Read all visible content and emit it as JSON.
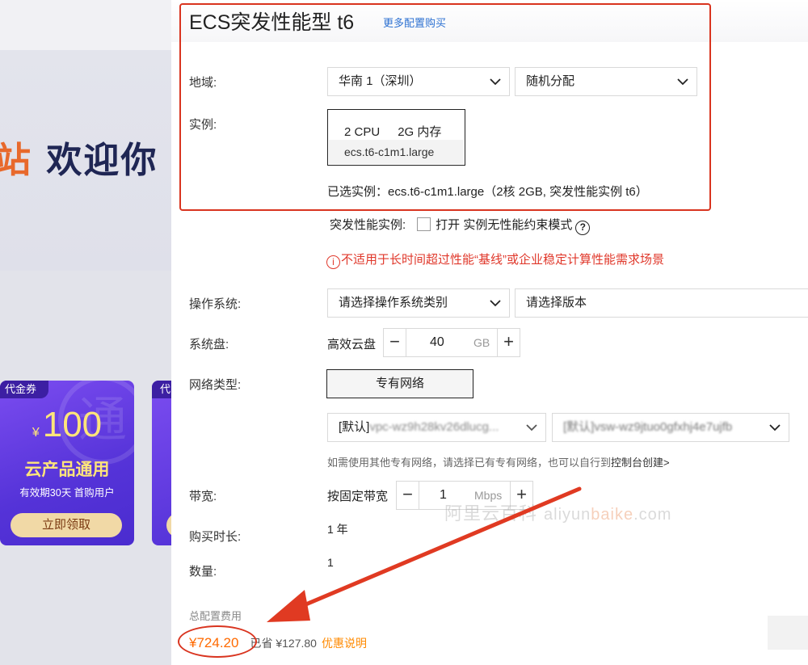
{
  "background": {
    "welcome_orange": "站",
    "welcome_navy": " 欢迎你",
    "coupon": {
      "tag": "代金券",
      "currency": "¥",
      "amount": "100",
      "title": "云产品通用",
      "subtitle": "有效期30天 首购用户",
      "claim_label": "立即领取",
      "deco": "通"
    },
    "coupon2": {
      "tag": "代"
    }
  },
  "config": {
    "product_title": "ECS突发性能型 t6",
    "more_config_link": "更多配置购买",
    "region": {
      "label": "地域:",
      "region_value": "华南 1（深圳）",
      "zone_value": "随机分配"
    },
    "instance": {
      "label": "实例:",
      "cpu": "2 CPU",
      "memory": "2G 内存",
      "code": "ecs.t6-c1m1.large"
    },
    "selected_instance": "已选实例：ecs.t6-c1m1.large（2核 2GB, 突发性能实例 t6）",
    "burst": {
      "label": "突发性能实例:",
      "option": "打开 实例无性能约束模式",
      "help": "?"
    },
    "warning": {
      "icon": "i",
      "text": "不适用于长时间超过性能“基线”或企业稳定计算性能需求场景"
    },
    "os": {
      "label": "操作系统:",
      "type_placeholder": "请选择操作系统类别",
      "version_placeholder": "请选择版本"
    },
    "disk": {
      "label": "系统盘:",
      "type": "高效云盘",
      "size": "40",
      "unit": "GB",
      "minus": "−",
      "plus": "+"
    },
    "network": {
      "label": "网络类型:",
      "type": "专有网络",
      "vpc_prefix": "[默认]",
      "vpc_value": "vpc-wz9h28kv26dlucg...",
      "vswitch_value": "[默认]vsw-wz9jtuo0gfxhj4e7ujfb",
      "hint": "如需使用其他专有网络，请选择已有专有网络，也可以自行到",
      "hint_link": "控制台创建>"
    },
    "bandwidth": {
      "label": "带宽:",
      "mode": "按固定带宽",
      "value": "1",
      "unit": "Mbps",
      "minus": "−",
      "plus": "+"
    },
    "duration": {
      "label": "购买时长:",
      "value": "1 年"
    },
    "quantity": {
      "label": "数量:",
      "value": "1"
    },
    "total": {
      "label": "总配置费用",
      "price": "¥724.20",
      "saved": "已省 ¥127.80",
      "discount_link": "优惠说明"
    }
  },
  "watermark": {
    "cn": "阿里云百科",
    "en_a": "aliyun",
    "en_b": "baike",
    "en_c": ".com"
  },
  "colors": {
    "highlight_red": "#d9341f",
    "price_orange": "#ff6a00",
    "link_blue": "#2e72d2",
    "warning_red": "#e0382b"
  }
}
